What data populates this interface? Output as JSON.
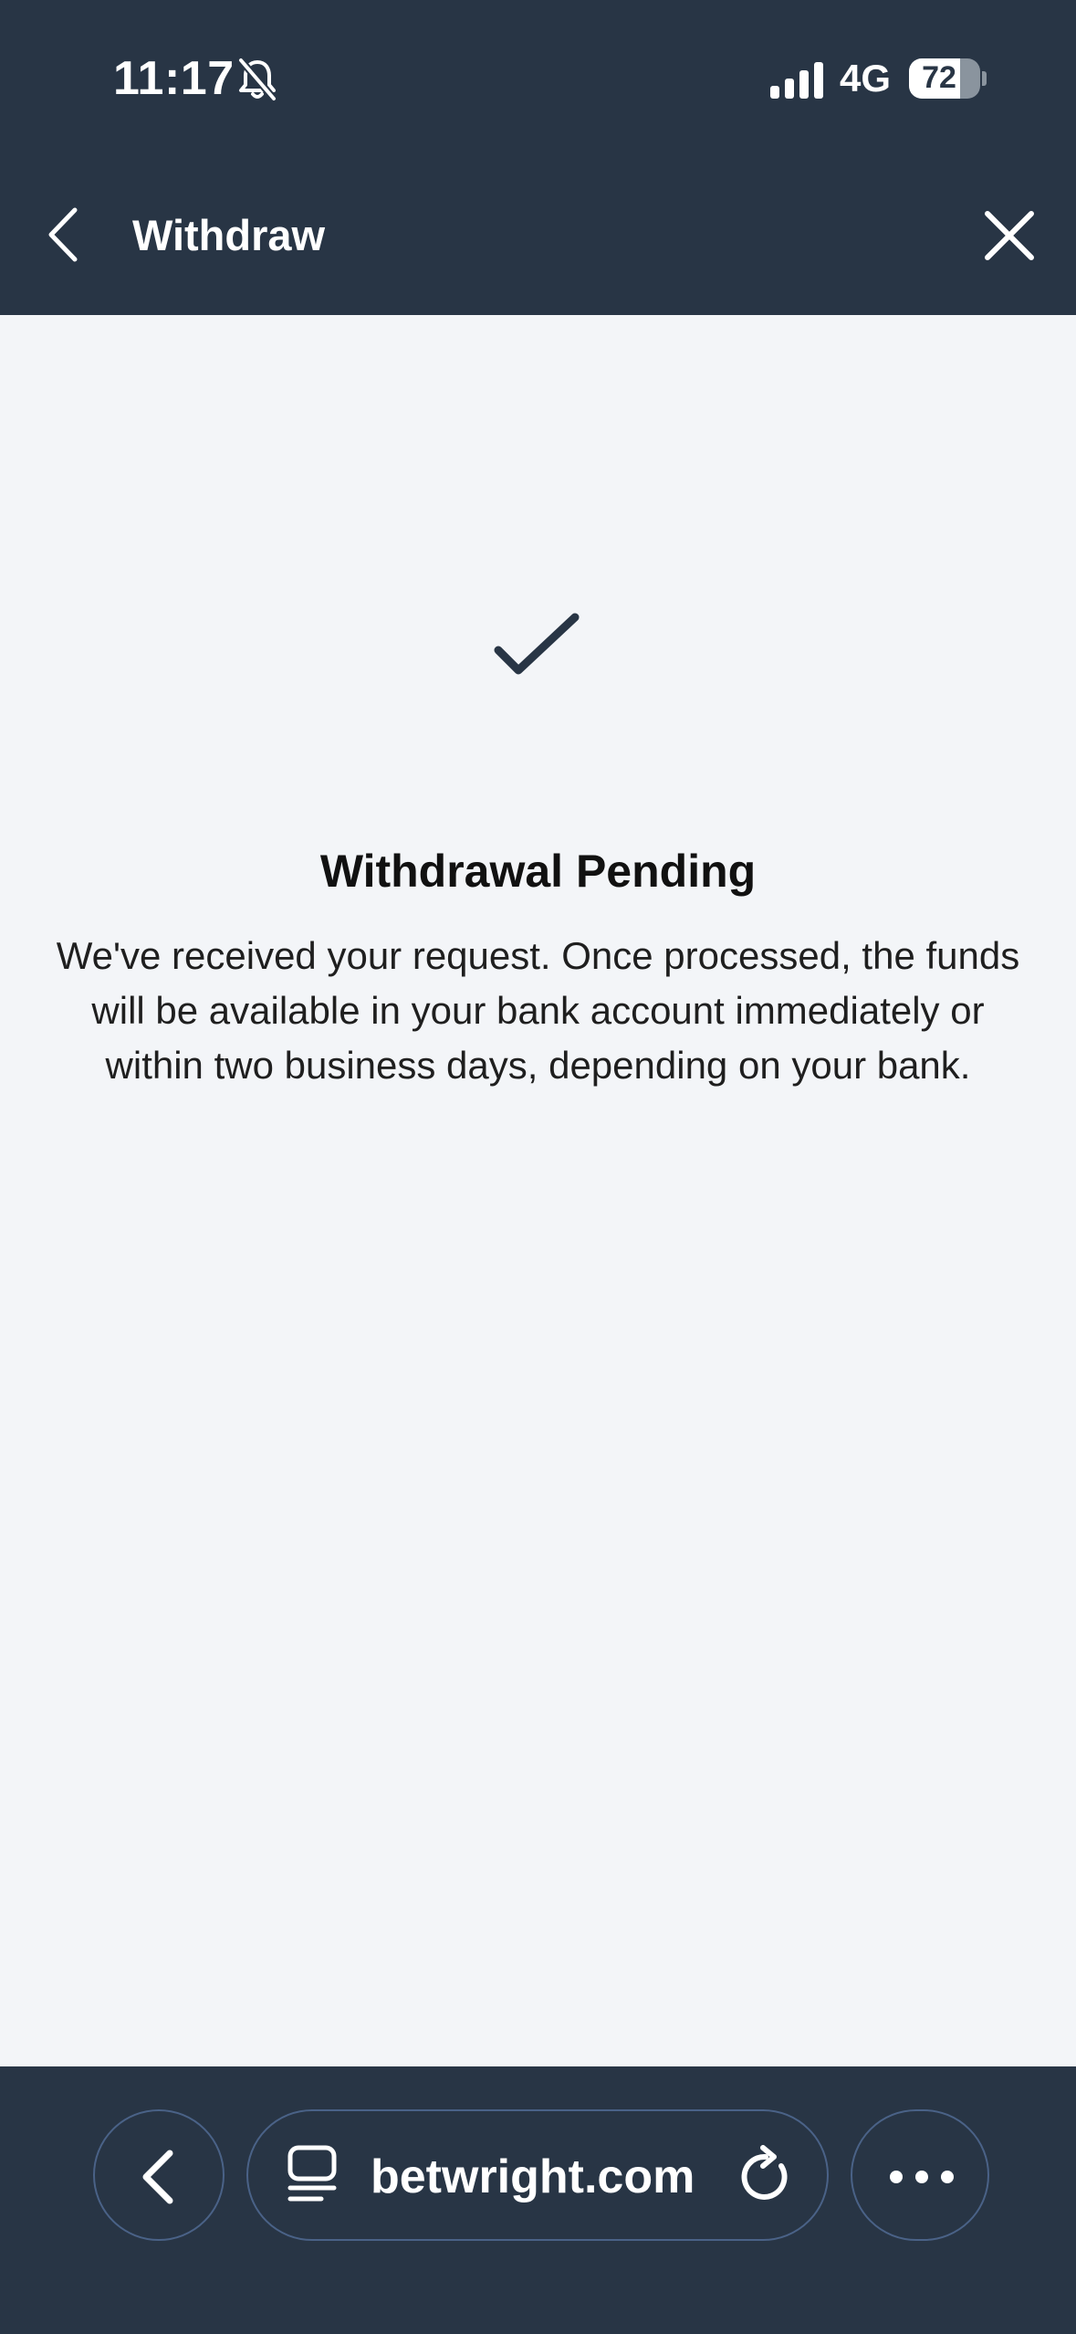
{
  "status_bar": {
    "time": "11:17",
    "network": "4G",
    "battery_level": "72",
    "battery_fraction": 0.72,
    "icons": [
      "bell-muted-icon",
      "signal-icon"
    ]
  },
  "header": {
    "title": "Withdraw",
    "back_icon": "chevron-left-icon",
    "close_icon": "close-icon"
  },
  "result": {
    "icon": "checkmark-icon",
    "title": "Withdrawal Pending",
    "message": "We've received your request. Once processed, the funds will be available in your bank account immediately or within two business days, depending on your bank."
  },
  "browser": {
    "url": "betwright.com",
    "icons": [
      "chevron-left-icon",
      "tabs-icon",
      "reload-icon",
      "more-icon"
    ]
  },
  "colors": {
    "header_bg": "#283545",
    "content_bg": "#f3f5f8",
    "pill_border": "#4a6287",
    "text_dark": "#111111"
  }
}
